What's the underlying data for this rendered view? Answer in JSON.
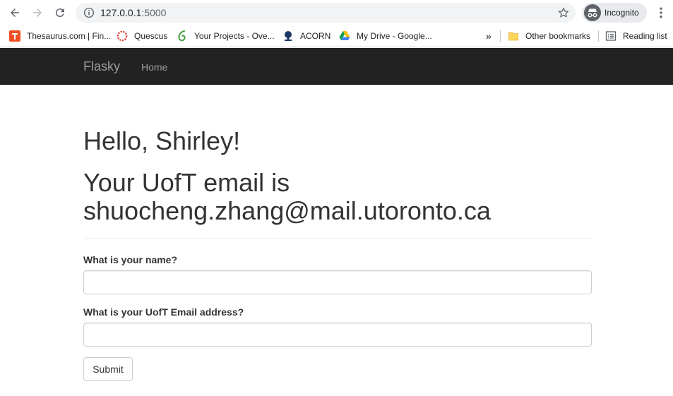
{
  "browser": {
    "url_host": "127.0.0.1",
    "url_port": ":5000",
    "profile_label": "Incognito",
    "bookmarks": [
      {
        "label": "Thesaurus.com | Fin...",
        "icon": "thesaurus-icon"
      },
      {
        "label": "Quescus",
        "icon": "quercus-icon"
      },
      {
        "label": "Your Projects - Ove...",
        "icon": "overleaf-icon"
      },
      {
        "label": "ACORN",
        "icon": "acorn-icon"
      },
      {
        "label": "My Drive - Google...",
        "icon": "google-drive-icon"
      }
    ],
    "overflow_label": "»",
    "other_bookmarks_label": "Other bookmarks",
    "reading_list_label": "Reading list"
  },
  "navbar": {
    "brand": "Flasky",
    "links": [
      {
        "label": "Home"
      }
    ]
  },
  "page": {
    "greeting": "Hello, Shirley!",
    "email_message": "Your UofT email is shuocheng.zhang@mail.utoronto.ca"
  },
  "form": {
    "name_label": "What is your name?",
    "name_value": "",
    "email_label": "What is your UofT Email address?",
    "email_value": "",
    "submit_label": "Submit"
  },
  "colors": {
    "navbar_bg": "#222222",
    "navbar_text": "#9d9d9d",
    "body_text": "#333333",
    "input_border": "#cccccc"
  }
}
